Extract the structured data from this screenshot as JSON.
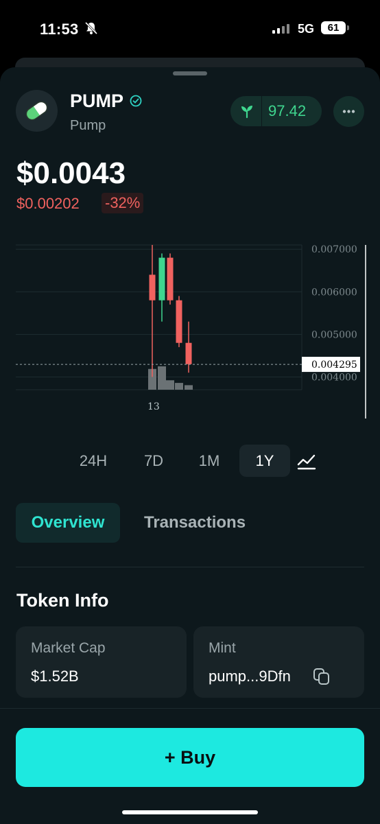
{
  "status_bar": {
    "time": "11:53",
    "network": "5G",
    "battery": "61"
  },
  "token": {
    "symbol": "PUMP",
    "name": "Pump",
    "score": "97.42",
    "price": "$0.0043",
    "change_abs": "$0.00202",
    "change_pct": "-32%"
  },
  "chart_data": {
    "type": "candlestick",
    "y_ticks": [
      "0.007000",
      "0.006000",
      "0.005000",
      "0.004000"
    ],
    "current_price_label": "0.004295",
    "x_tick_label": "13",
    "candles": [
      {
        "open": 0.0058,
        "high": 0.0071,
        "low": 0.004,
        "close": 0.0064,
        "color": "red"
      },
      {
        "open": 0.0058,
        "high": 0.0069,
        "low": 0.0053,
        "close": 0.0068,
        "color": "green"
      },
      {
        "open": 0.0068,
        "high": 0.0069,
        "low": 0.0057,
        "close": 0.0058,
        "color": "red"
      },
      {
        "open": 0.0058,
        "high": 0.0059,
        "low": 0.0047,
        "close": 0.0048,
        "color": "red"
      },
      {
        "open": 0.0048,
        "high": 0.0053,
        "low": 0.0041,
        "close": 0.0043,
        "color": "red"
      }
    ],
    "volume": [
      0.55,
      0.62,
      0.25,
      0.18,
      0.12
    ],
    "y_range": [
      0.0037,
      0.0071
    ]
  },
  "ranges": [
    "24H",
    "7D",
    "1M",
    "1Y"
  ],
  "active_range": "1Y",
  "tabs": {
    "overview": "Overview",
    "transactions": "Transactions"
  },
  "token_info": {
    "title": "Token Info",
    "market_cap_label": "Market Cap",
    "market_cap_value": "$1.52B",
    "mint_label": "Mint",
    "mint_value": "pump...9Dfn"
  },
  "buy": {
    "label": "+  Buy"
  },
  "colors": {
    "accent": "#1de9e0",
    "up": "#3fd68f",
    "down": "#f0625f",
    "background": "#0d181c"
  }
}
